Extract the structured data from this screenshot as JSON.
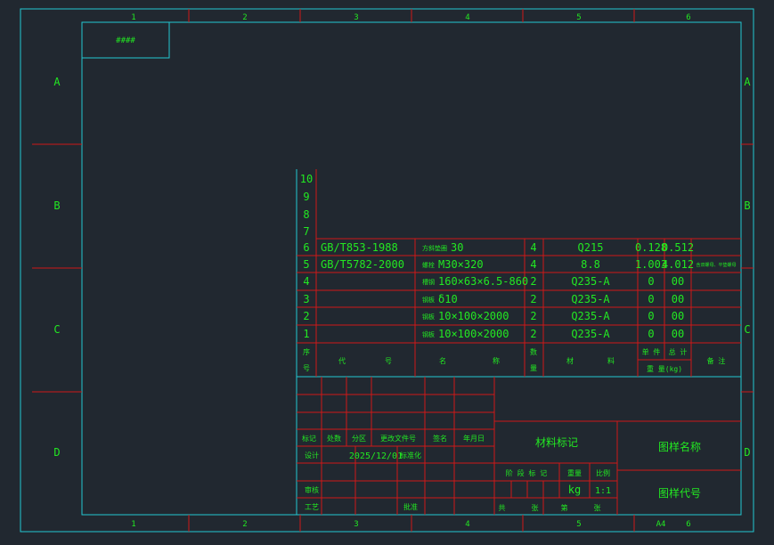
{
  "sheet": {
    "zone_columns": [
      "1",
      "2",
      "3",
      "4",
      "5",
      "6"
    ],
    "zone_rows": [
      "A",
      "B",
      "C",
      "D"
    ],
    "corner_tag": "####",
    "paper_size": "A4"
  },
  "bom": {
    "empty_row_numbers": [
      "10",
      "9",
      "8",
      "7"
    ],
    "rows": [
      {
        "no": "6",
        "code": "GB/T853-1988",
        "name_small": "方斜垫圈",
        "name": "30",
        "qty": "4",
        "material": "Q215",
        "unit_weight": "0.128",
        "total_weight": "0.512",
        "remark": ""
      },
      {
        "no": "5",
        "code": "GB/T5782-2000",
        "name_small": "螺栓",
        "name": "M30×320",
        "qty": "4",
        "material": "8.8",
        "unit_weight": "1.003",
        "total_weight": "4.012",
        "remark": "含双螺母、平垫螺母"
      },
      {
        "no": "4",
        "code": "",
        "name_small": "槽钢",
        "name": "160×63×6.5-860",
        "qty": "2",
        "material": "Q235-A",
        "unit_weight": "0",
        "total_weight": "00",
        "remark": ""
      },
      {
        "no": "3",
        "code": "",
        "name_small": "钢板",
        "name": "δ10",
        "qty": "2",
        "material": "Q235-A",
        "unit_weight": "0",
        "total_weight": "00",
        "remark": ""
      },
      {
        "no": "2",
        "code": "",
        "name_small": "钢板",
        "name": "10×100×2000",
        "qty": "2",
        "material": "Q235-A",
        "unit_weight": "0",
        "total_weight": "00",
        "remark": ""
      },
      {
        "no": "1",
        "code": "",
        "name_small": "钢板",
        "name": "10×100×2000",
        "qty": "2",
        "material": "Q235-A",
        "unit_weight": "0",
        "total_weight": "00",
        "remark": ""
      }
    ],
    "header": {
      "seq": [
        "序",
        "号"
      ],
      "code": [
        "代",
        "号"
      ],
      "name": [
        "名",
        "称"
      ],
      "qty": [
        "数",
        "量"
      ],
      "material": [
        "材",
        "料"
      ],
      "unit": "单 件",
      "total": "总 计",
      "weight": "重 量(kg)",
      "remark": "备 注"
    }
  },
  "title_block": {
    "rev_labels": [
      "标记",
      "处数",
      "分区",
      "更改文件号",
      "签名",
      "年月日"
    ],
    "design_label": "设计",
    "design_date": "2025/12/01",
    "standardize_label": "标准化",
    "review_label": "审核",
    "process_label": "工艺",
    "approve_label": "批准",
    "material_mark": "材料标记",
    "stage_mark": "阶 段 标 记",
    "weight_label": "重量",
    "scale_label": "比例",
    "weight_unit": "kg",
    "scale_value": "1:1",
    "sheets_total": "共      张",
    "sheet_no": "第      张",
    "drawing_name": "图样名称",
    "drawing_code": "图样代号"
  }
}
